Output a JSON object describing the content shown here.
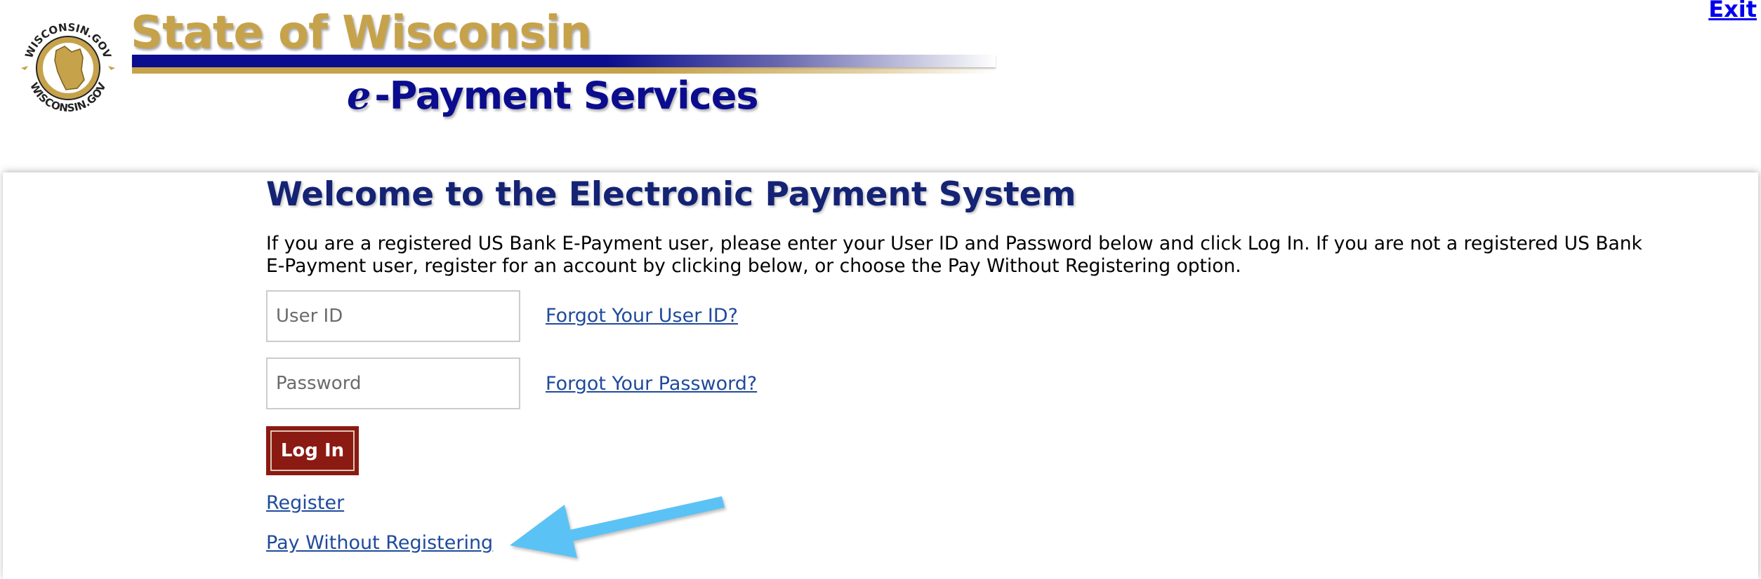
{
  "header": {
    "logo_alt": "WISCONSIN.GOV",
    "logo_ring_text": "WISCONSIN.GOV",
    "title": "State of Wisconsin",
    "subtitle_prefix": "e",
    "subtitle": "-Payment Services",
    "exit_label": "Exit"
  },
  "main": {
    "title": "Welcome to the Electronic Payment System",
    "intro": "If you are a registered US Bank E-Payment user, please enter your User ID and Password below and click Log In. If you are not a registered US Bank E-Payment user, register for an account by clicking below, or choose the Pay Without Registering option.",
    "userid_placeholder": "User ID",
    "userid_value": "",
    "password_placeholder": "Password",
    "password_value": "",
    "forgot_userid_label": "Forgot Your User ID?",
    "forgot_password_label": "Forgot Your Password?",
    "login_label": "Log In",
    "register_label": "Register",
    "pay_without_label": "Pay Without Registering"
  },
  "annotation": {
    "arrow_icon": "arrow-pointing-left",
    "arrow_color": "#5bc2f5"
  },
  "colors": {
    "gold": "#c6a24a",
    "navy": "#0b0d8e",
    "title_navy": "#142374",
    "link_blue": "#1f4a9c",
    "button_red": "#8b1a12",
    "exit_blue": "#0000ee"
  }
}
